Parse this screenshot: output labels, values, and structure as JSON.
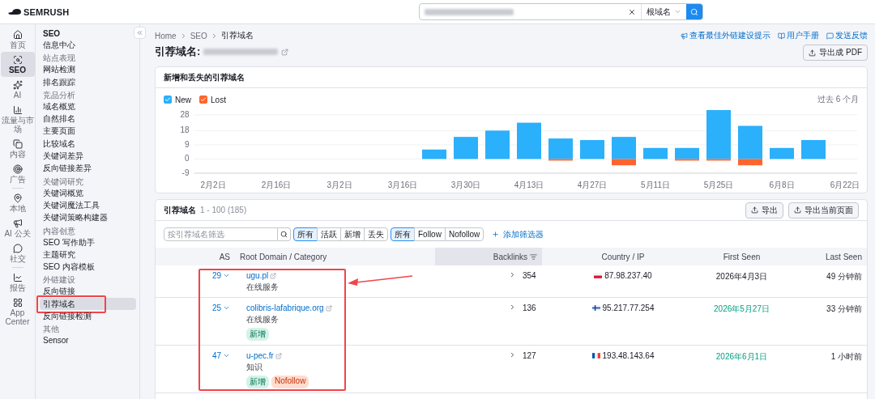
{
  "header": {
    "logo": "SEMRUSH",
    "search": {
      "scope": "根域名"
    }
  },
  "rail": [
    {
      "label": "首页",
      "selected": false,
      "divider_after": false
    },
    {
      "label": "SEO",
      "selected": true,
      "divider_after": false
    },
    {
      "label": "AI",
      "selected": false,
      "divider_after": false
    },
    {
      "label": "流量与市场",
      "selected": false,
      "divider_after": false
    },
    {
      "label": "内容",
      "selected": false,
      "divider_after": false
    },
    {
      "label": "广告",
      "selected": false,
      "divider_after": true
    },
    {
      "label": "本地",
      "selected": false,
      "divider_after": false
    },
    {
      "label": "AI 公关",
      "selected": false,
      "divider_after": false
    },
    {
      "label": "社交",
      "selected": false,
      "divider_after": true
    },
    {
      "label": "报告",
      "selected": false,
      "divider_after": false
    },
    {
      "label": "App Center",
      "selected": false,
      "divider_after": false
    }
  ],
  "nav": {
    "title": "SEO",
    "sections": [
      {
        "items": [
          {
            "label": "信息中心",
            "selected": false
          }
        ]
      },
      {
        "heading": "站点表现",
        "items": [
          {
            "label": "网站检测",
            "selected": false
          },
          {
            "label": "排名跟踪",
            "selected": false
          }
        ]
      },
      {
        "heading": "竞品分析",
        "items": [
          {
            "label": "域名概览",
            "selected": false
          },
          {
            "label": "自然排名",
            "selected": false
          },
          {
            "label": "主要页面",
            "selected": false
          },
          {
            "label": "比较域名",
            "selected": false
          },
          {
            "label": "关键词差异",
            "selected": false
          },
          {
            "label": "反向链接差异",
            "selected": false
          }
        ]
      },
      {
        "heading": "关键词研究",
        "items": [
          {
            "label": "关键词概览",
            "selected": false
          },
          {
            "label": "关键词魔法工具",
            "selected": false
          },
          {
            "label": "关键词策略构建器",
            "selected": false
          }
        ]
      },
      {
        "heading": "内容创意",
        "items": [
          {
            "label": "SEO 写作助手",
            "selected": false
          },
          {
            "label": "主题研究",
            "selected": false
          },
          {
            "label": "SEO 内容模板",
            "selected": false
          }
        ]
      },
      {
        "heading": "外链建设",
        "items": [
          {
            "label": "反向链接",
            "selected": false
          },
          {
            "label": "引荐域名",
            "selected": true
          },
          {
            "label": "反向链接检测",
            "selected": false
          }
        ]
      },
      {
        "heading": "其他",
        "items": [
          {
            "label": "Sensor",
            "selected": false
          }
        ]
      }
    ]
  },
  "breadcrumbs": [
    "Home",
    "SEO",
    "引荐域名"
  ],
  "page_title": "引荐域名:",
  "top_links": [
    "查看最佳外链建设提示",
    "用户手册",
    "发送反馈"
  ],
  "export_pdf": "导出成 PDF",
  "chart_card": {
    "title": "新增和丢失的引荐域名",
    "legend": [
      {
        "checked": true
      },
      {
        "checked": true
      }
    ],
    "period": "过去 6 个月",
    "chart_data": {
      "type": "bar",
      "stacked": true,
      "grid": true,
      "categories": [
        "2月2日",
        null,
        "2月16日",
        null,
        "3月2日",
        null,
        "3月16日",
        null,
        "3月30日",
        null,
        "4月13日",
        null,
        "4月27日",
        null,
        "5月11日",
        null,
        "5月25日",
        null,
        "6月8日",
        null,
        "6月22日"
      ],
      "series": [
        {
          "name": "New",
          "color": "#2bb0fb",
          "values": [
            null,
            null,
            null,
            null,
            null,
            null,
            null,
            6,
            14,
            18,
            23,
            13,
            12,
            14,
            7,
            7,
            31,
            21,
            7,
            12,
            null
          ]
        },
        {
          "name": "Lost",
          "color": "#ff642d",
          "values": [
            null,
            null,
            null,
            null,
            null,
            null,
            null,
            0,
            0,
            0,
            0,
            -1,
            0,
            -4,
            0,
            -1,
            -1,
            -4,
            0,
            0,
            null
          ]
        }
      ],
      "ylim": [
        -9,
        31
      ],
      "yticks": [
        28,
        18,
        9,
        0,
        -9
      ]
    }
  },
  "table_card": {
    "title": "引荐域名",
    "range": "1 - 100 (185)",
    "buttons": [
      "导出",
      "导出当前页面"
    ],
    "filter": {
      "placeholder": "按引荐域名筛选"
    },
    "segments": [
      [
        {
          "label": "所有",
          "selected": true
        },
        {
          "label": "活跃",
          "selected": false
        },
        {
          "label": "新增",
          "selected": false
        },
        {
          "label": "丢失",
          "selected": false
        }
      ],
      [
        {
          "label": "所有",
          "selected": true
        },
        {
          "label": "Follow",
          "selected": false
        },
        {
          "label": "Nofollow",
          "selected": false
        }
      ]
    ],
    "add_filter": "添加筛选器",
    "columns": [
      {
        "label": "AS",
        "sorted": false
      },
      {
        "label": "Root Domain / Category",
        "sorted": false
      },
      {
        "label": "Backlinks",
        "sorted": true
      },
      {
        "label": "Country / IP",
        "sorted": false
      },
      {
        "label": "First Seen",
        "sorted": false
      },
      {
        "label": "Last Seen",
        "sorted": false
      }
    ],
    "rows": [
      {
        "as": "29",
        "domain": "ugu.pl",
        "category": "在线服务",
        "tags": [],
        "backlinks": "354",
        "kind": "pl",
        "ip": "87.98.237.40",
        "first_seen": "2026年4月3日",
        "recent": false,
        "last_seen": "49 分钟前"
      },
      {
        "as": "25",
        "domain": "colibris-lafabrique.org",
        "category": "在线服务",
        "tags": [
          {
            "label": "新增",
            "kind": "new"
          }
        ],
        "backlinks": "136",
        "kind": "fi",
        "ip": "95.217.77.254",
        "first_seen": "2026年5月27日",
        "recent": true,
        "last_seen": "33 分钟前"
      },
      {
        "as": "47",
        "domain": "u-pec.fr",
        "category": "知识",
        "tags": [
          {
            "label": "新增",
            "kind": "new"
          },
          {
            "label": "Nofollow",
            "kind": "nofollow"
          }
        ],
        "backlinks": "127",
        "kind": "fr",
        "ip": "193.48.143.64",
        "first_seen": "2026年6月1日",
        "recent": true,
        "last_seen": "1 小时前"
      }
    ]
  },
  "annotations": [
    {
      "kind": "navbox"
    },
    {
      "kind": "rowsbox"
    },
    {
      "kind": "arrow"
    }
  ]
}
